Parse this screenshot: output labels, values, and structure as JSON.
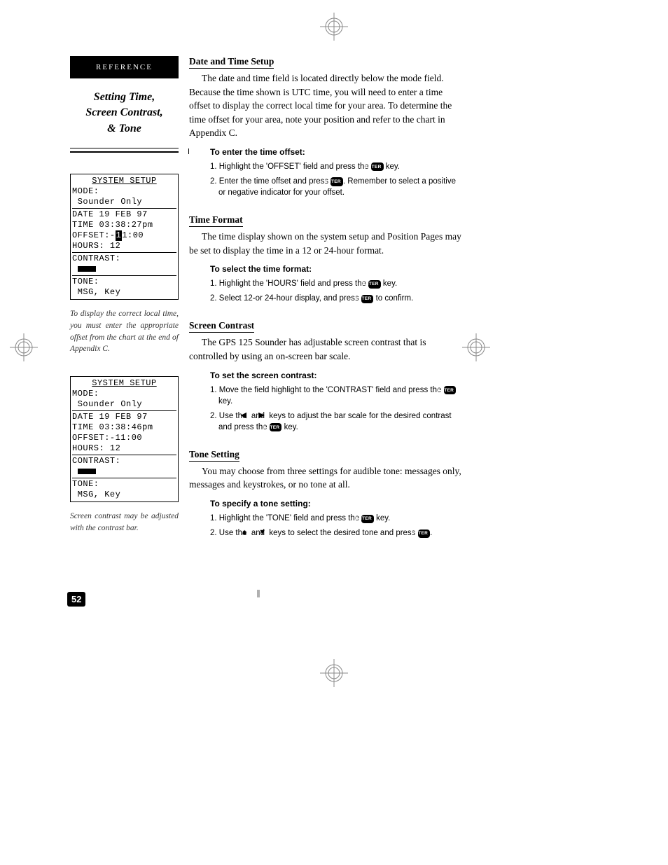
{
  "header": {
    "reference": "REFERENCE",
    "title_l1": "Setting Time,",
    "title_l2": "Screen Contrast,",
    "title_l3": "& Tone"
  },
  "lcd1": {
    "title": "SYSTEM SETUP",
    "mode_lbl": "MODE:",
    "mode_val": "Sounder Only",
    "date": "DATE 19 FEB 97",
    "time": "TIME 03:38:27pm",
    "offset_pre": "OFFSET:-",
    "offset_sel": "1",
    "offset_post": "1:00",
    "hours": "HOURS:  12",
    "contrast": "CONTRAST:",
    "tone": "TONE:",
    "tone_val": "MSG, Key"
  },
  "caption1": "To display the correct local time, you must enter the appropriate offset from the chart at the end of Appendix C.",
  "lcd2": {
    "title": "SYSTEM SETUP",
    "mode_lbl": "MODE:",
    "mode_val": "Sounder Only",
    "date": "DATE 19 FEB 97",
    "time": "TIME 03:38:46pm",
    "offset": "OFFSET:-11:00",
    "hours": "HOURS:  12",
    "contrast": "CONTRAST:",
    "tone": "TONE:",
    "tone_val": "MSG, Key"
  },
  "caption2": "Screen contrast may be adjusted with the contrast bar.",
  "page_number": "52",
  "sections": {
    "date": {
      "head": "Date and Time Setup",
      "body": "The date and time field is located directly below the mode field. Because the time shown is UTC time, you will need to enter a time offset to display the correct local time for your area. To determine the time offset for your area, note your position and refer to the chart in Appendix C.",
      "sub": "To enter the time offset:",
      "step1a": "1. Highlight the 'OFFSET' field and press the ",
      "step1b": " key.",
      "step2a": "2. Enter the time offset and press ",
      "step2b": ". Remember to select a positive or negative indicator for your offset."
    },
    "time": {
      "head": "Time Format",
      "body": "The time display shown on the system setup and Position Pages may be set to display the time in a 12 or 24-hour format.",
      "sub": "To select the time format:",
      "step1a": "1. Highlight the 'HOURS' field and press the ",
      "step1b": " key.",
      "step2a": "2.  Select  12-or 24-hour display, and press ",
      "step2b": " to confirm."
    },
    "contrast": {
      "head": "Screen Contrast",
      "body": "The GPS 125 Sounder has adjustable screen contrast that is controlled by using an on-screen bar scale.",
      "sub": "To set the screen contrast:",
      "step1a": "1. Move the field highlight to the 'CONTRAST' field and press the ",
      "step1b": " key.",
      "step2a": "2. Use the ",
      "step2b": " and ",
      "step2c": " keys to adjust the bar scale for the desired contrast and press the ",
      "step2d": " key."
    },
    "tone": {
      "head": "Tone Setting",
      "body": "You may choose from three settings for audible tone: messages only, messages and keystrokes, or no tone at all.",
      "sub": "To specify a tone setting:",
      "step1a": "1. Highlight the 'TONE' field and press the ",
      "step1b": " key.",
      "step2a": "2. Use the ",
      "step2b": " and ",
      "step2c": " keys to select the desired tone and press ",
      "step2d": "."
    }
  },
  "keys": {
    "enter": "ENTER"
  }
}
